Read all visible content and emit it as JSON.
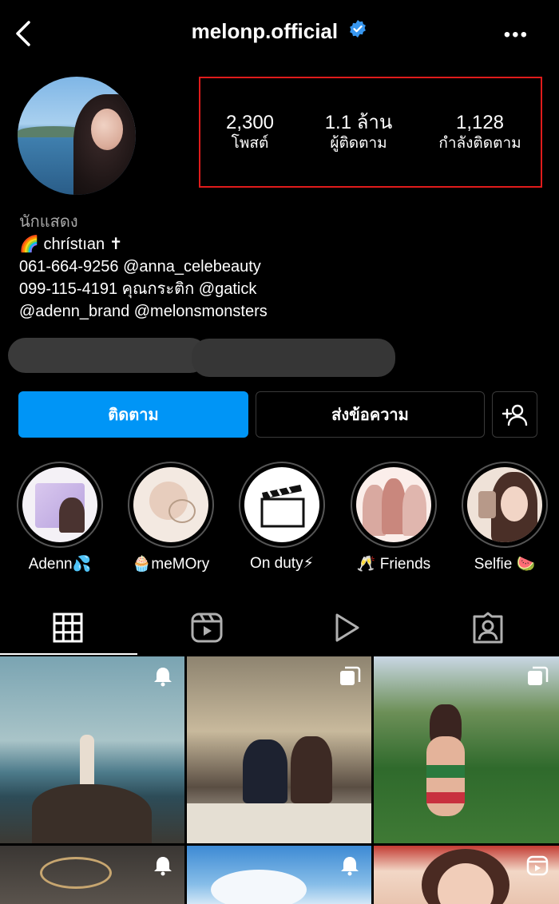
{
  "header": {
    "username": "melonp.official",
    "back_icon": "chevron-left-icon",
    "verified_icon": "verified-badge-icon",
    "more_icon": "more-horizontal-icon",
    "more_glyph": "•••"
  },
  "stats": {
    "posts": {
      "value": "2,300",
      "label": "โพสต์"
    },
    "followers": {
      "value": "1.1 ล้าน",
      "label": "ผู้ติดตาม"
    },
    "following": {
      "value": "1,128",
      "label": "กำลังติดตาม"
    }
  },
  "bio": {
    "category": "นักแสดง",
    "line1": "🌈 chrístıan ✝",
    "line2": "061-664-9256 @anna_celebeauty",
    "line3": "099-115-4191 คุณกระติก @gatick",
    "line4": "@adenn_brand @melonsmonsters"
  },
  "actions": {
    "follow": "ติดตาม",
    "message": "ส่งข้อความ",
    "add_user_icon": "add-user-icon"
  },
  "highlights": [
    {
      "label": "Adenn💦"
    },
    {
      "label": "🧁meMOry"
    },
    {
      "label": "On duty⚡"
    },
    {
      "label": "🥂 Friends"
    },
    {
      "label": "Selfie 🍉"
    }
  ],
  "tabs": [
    {
      "icon": "grid-icon",
      "active": true
    },
    {
      "icon": "reels-icon",
      "active": false
    },
    {
      "icon": "play-icon",
      "active": false
    },
    {
      "icon": "tagged-icon",
      "active": false
    }
  ],
  "colors": {
    "accent": "#0095f6",
    "highlight_box": "#e01b1b",
    "verified": "#3897f0",
    "background": "#000000"
  }
}
